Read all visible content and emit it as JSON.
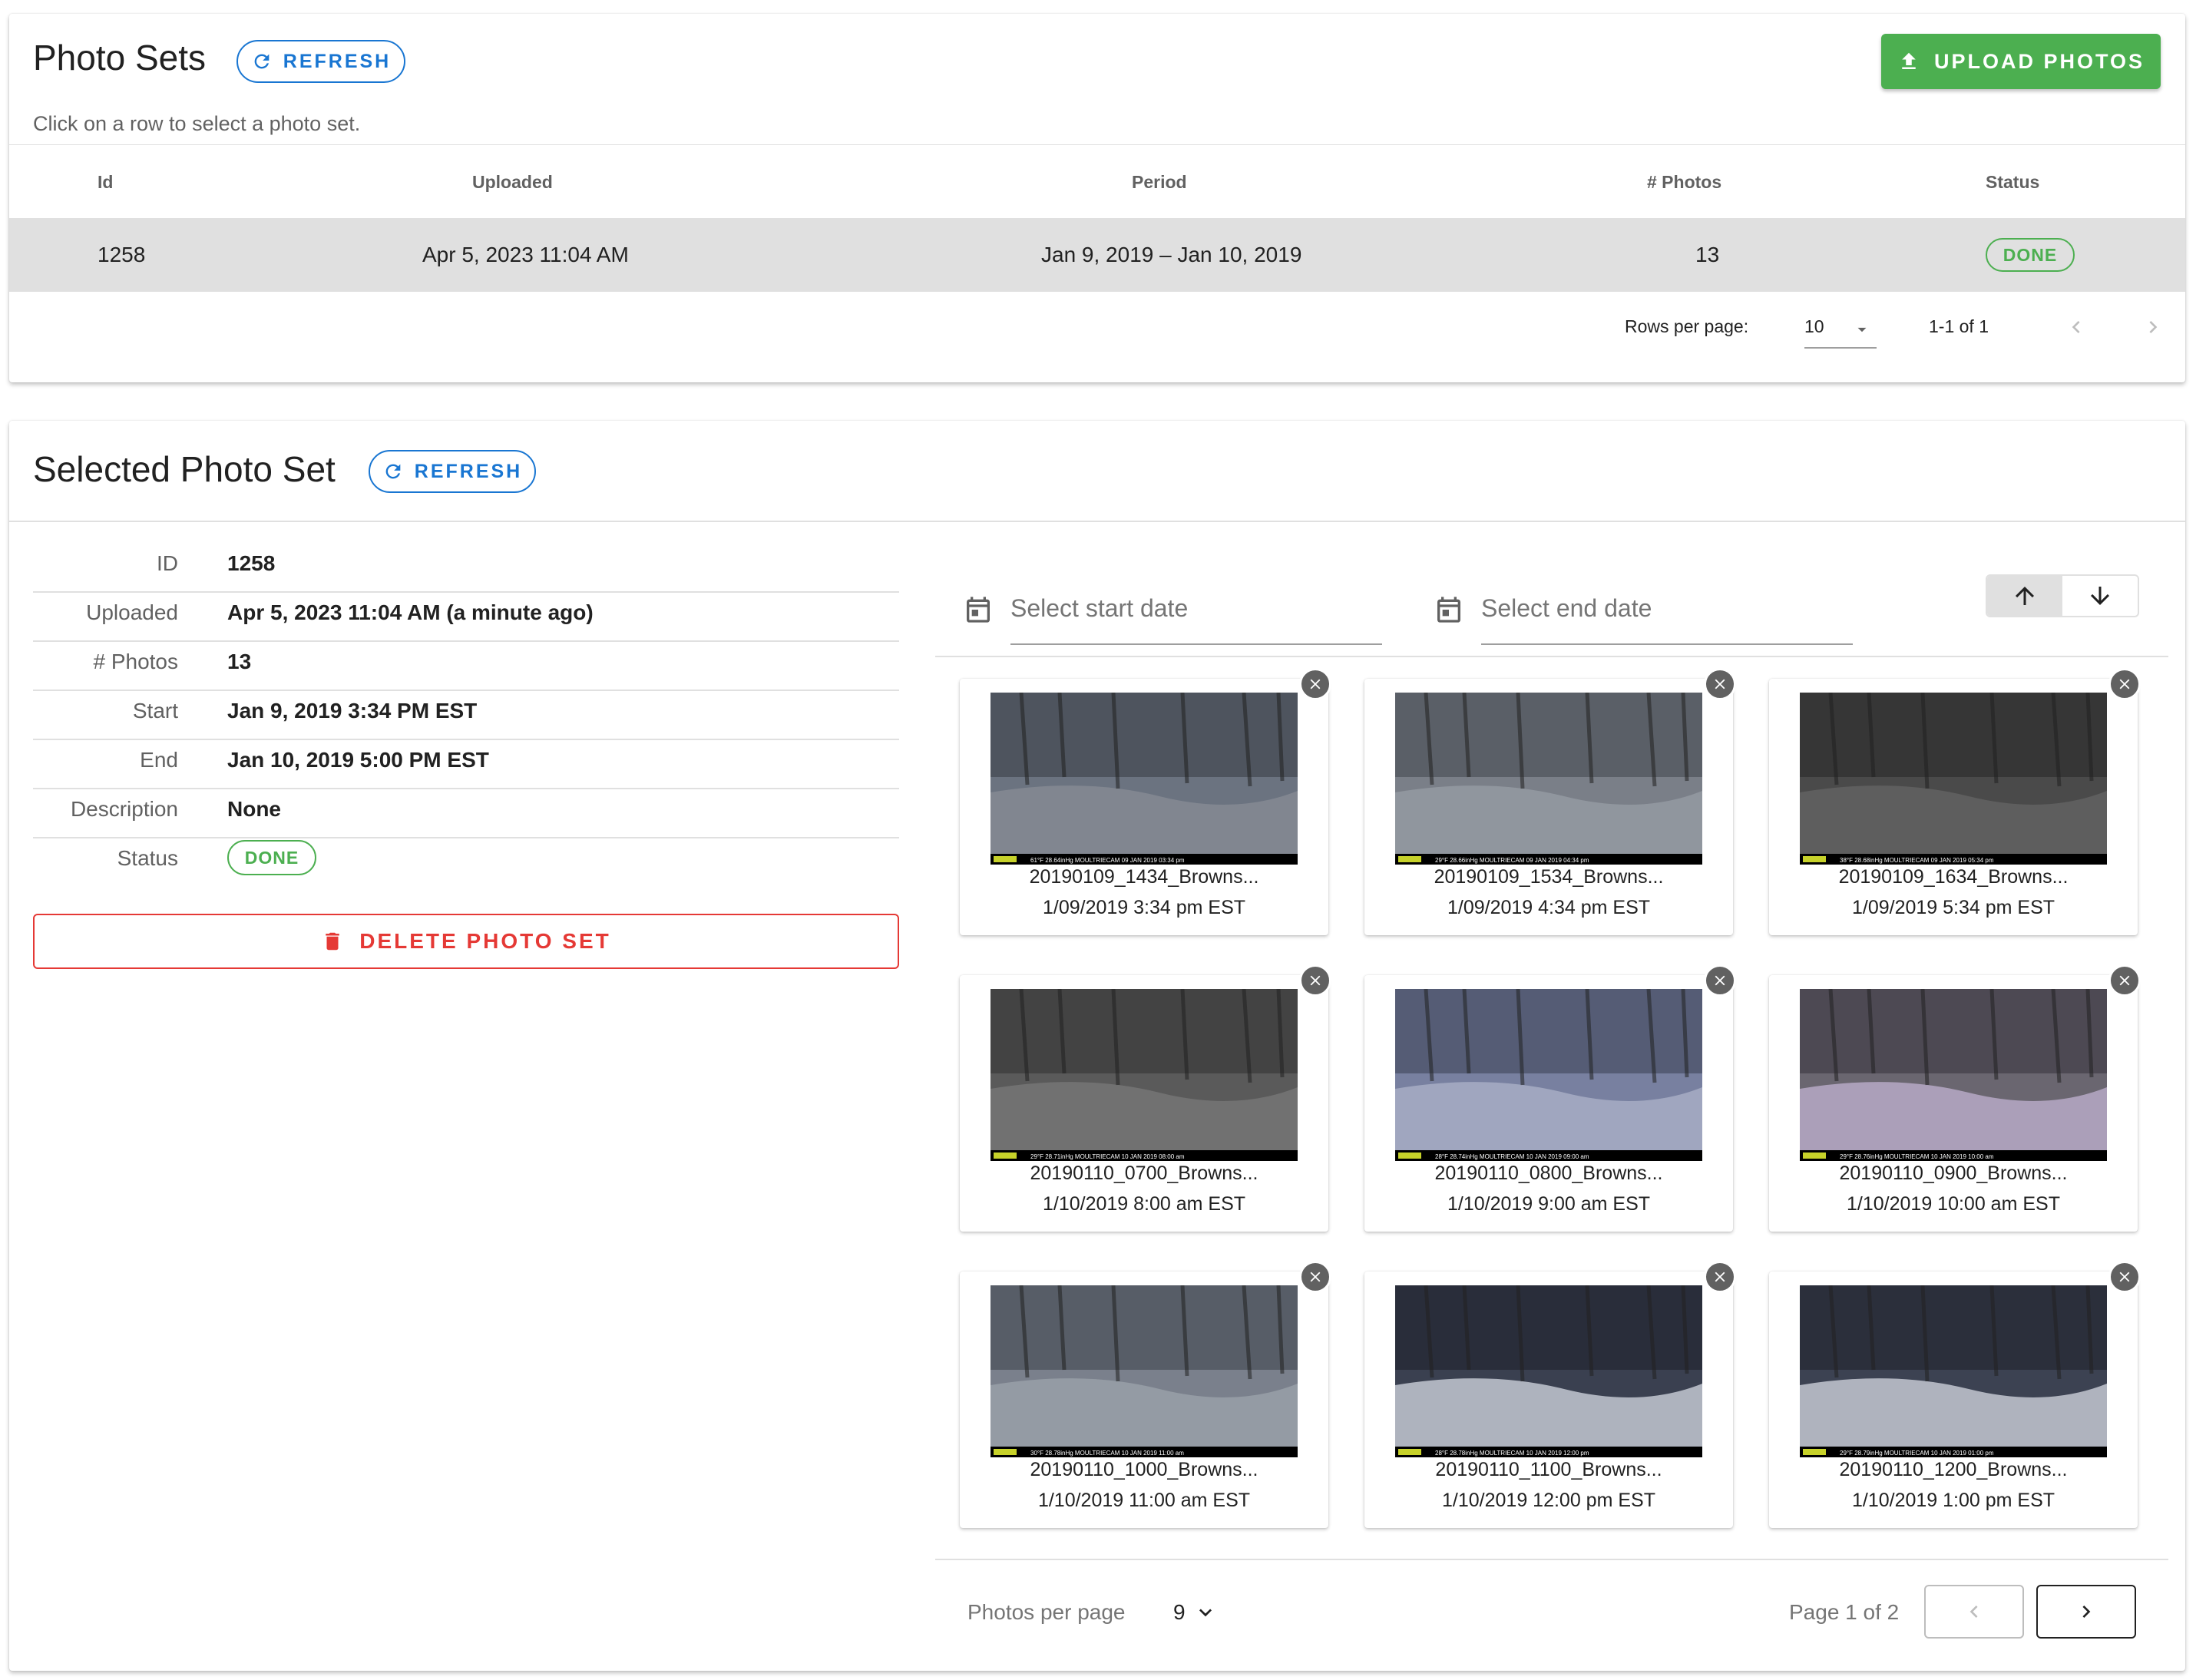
{
  "photo_sets": {
    "title": "Photo Sets",
    "refresh_label": "REFRESH",
    "upload_label": "UPLOAD PHOTOS",
    "subtitle": "Click on a row to select a photo set.",
    "columns": [
      "Id",
      "Uploaded",
      "Period",
      "# Photos",
      "Status"
    ],
    "rows": [
      {
        "id": "1258",
        "uploaded": "Apr 5, 2023 11:04 AM",
        "period": "Jan 9, 2019 – Jan 10, 2019",
        "photos": "13",
        "status": "DONE"
      }
    ],
    "rows_per_page_label": "Rows per page:",
    "rows_per_page": "10",
    "range": "1-1 of 1"
  },
  "selected": {
    "title": "Selected Photo Set",
    "refresh_label": "REFRESH",
    "details": [
      {
        "label": "ID",
        "value": "1258"
      },
      {
        "label": "Uploaded",
        "value": "Apr 5, 2023 11:04 AM (a minute ago)"
      },
      {
        "label": "# Photos",
        "value": "13"
      },
      {
        "label": "Start",
        "value": "Jan 9, 2019 3:34 PM EST"
      },
      {
        "label": "End",
        "value": "Jan 10, 2019 5:00 PM EST"
      },
      {
        "label": "Description",
        "value": "None"
      },
      {
        "label": "Status",
        "value": "DONE"
      }
    ],
    "delete_label": "DELETE PHOTO SET",
    "start_placeholder": "Select start date",
    "end_placeholder": "Select end date",
    "photos": [
      {
        "name": "20190109_1434_Browns...",
        "date": "1/09/2019 3:34 pm EST",
        "overlay": "61°F 28.64inHg  MOULTRIECAM  09 JAN 2019 03:34 pm"
      },
      {
        "name": "20190109_1534_Browns...",
        "date": "1/09/2019 4:34 pm EST",
        "overlay": "29°F 28.66inHg  MOULTRIECAM  09 JAN 2019 04:34 pm"
      },
      {
        "name": "20190109_1634_Browns...",
        "date": "1/09/2019 5:34 pm EST",
        "overlay": "38°F 28.68inHg  MOULTRIECAM  09 JAN 2019 05:34 pm"
      },
      {
        "name": "20190110_0700_Browns...",
        "date": "1/10/2019 8:00 am EST",
        "overlay": "29°F 28.71inHg  MOULTRIECAM  10 JAN 2019 08:00 am"
      },
      {
        "name": "20190110_0800_Browns...",
        "date": "1/10/2019 9:00 am EST",
        "overlay": "28°F 28.74inHg  MOULTRIECAM  10 JAN 2019 09:00 am"
      },
      {
        "name": "20190110_0900_Browns...",
        "date": "1/10/2019 10:00 am EST",
        "overlay": "29°F 28.76inHg  MOULTRIECAM  10 JAN 2019 10:00 am"
      },
      {
        "name": "20190110_1000_Browns...",
        "date": "1/10/2019 11:00 am EST",
        "overlay": "30°F 28.78inHg  MOULTRIECAM  10 JAN 2019 11:00 am"
      },
      {
        "name": "20190110_1100_Browns...",
        "date": "1/10/2019 12:00 pm EST",
        "overlay": "28°F 28.78inHg  MOULTRIECAM  10 JAN 2019 12:00 pm"
      },
      {
        "name": "20190110_1200_Browns...",
        "date": "1/10/2019 1:00 pm EST",
        "overlay": "29°F 28.79inHg  MOULTRIECAM  10 JAN 2019 01:00 pm"
      }
    ],
    "photos_per_page_label": "Photos per page",
    "photos_per_page": "9",
    "page_label": "Page 1 of 2"
  },
  "colors": {
    "accent": "#1976d2",
    "success": "#4caf50",
    "danger": "#e53935",
    "selected_row": "#e0e0e0"
  },
  "icons": [
    "refresh-icon",
    "upload-icon",
    "chevron-left-icon",
    "chevron-right-icon",
    "caret-down-icon",
    "trash-icon",
    "calendar-icon",
    "arrow-up-icon",
    "arrow-down-icon",
    "close-circle-icon"
  ]
}
